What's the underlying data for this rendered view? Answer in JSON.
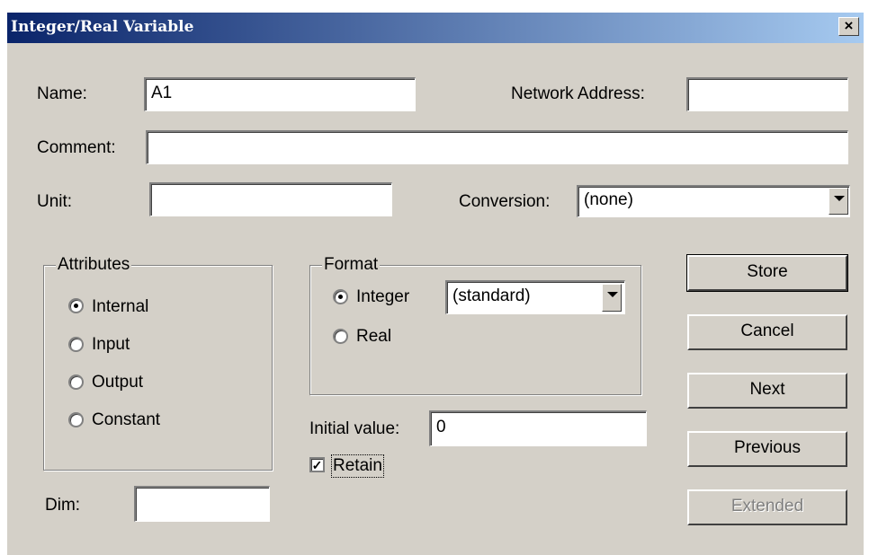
{
  "window": {
    "title": "Integer/Real Variable",
    "close_glyph": "×"
  },
  "fields": {
    "name_label": "Name:",
    "name_value": "A1",
    "network_address_label": "Network Address:",
    "network_address_value": "",
    "comment_label": "Comment:",
    "comment_value": "",
    "unit_label": "Unit:",
    "unit_value": "",
    "conversion_label": "Conversion:",
    "conversion_value": "(none)",
    "dim_label": "Dim:",
    "dim_value": ""
  },
  "attributes": {
    "legend": "Attributes",
    "options": [
      "Internal",
      "Input",
      "Output",
      "Constant"
    ],
    "selected": "Internal"
  },
  "format": {
    "legend": "Format",
    "options": [
      "Integer",
      "Real"
    ],
    "selected": "Integer",
    "integer_format_value": "(standard)"
  },
  "initial_value": {
    "label": "Initial value:",
    "value": "0"
  },
  "retain": {
    "label": "Retain",
    "checked": true
  },
  "buttons": {
    "store": "Store",
    "cancel": "Cancel",
    "next": "Next",
    "previous": "Previous",
    "extended": "Extended"
  },
  "colors": {
    "title_start": "#0a246a",
    "title_end": "#a6caf0",
    "face": "#d4d0c8"
  }
}
